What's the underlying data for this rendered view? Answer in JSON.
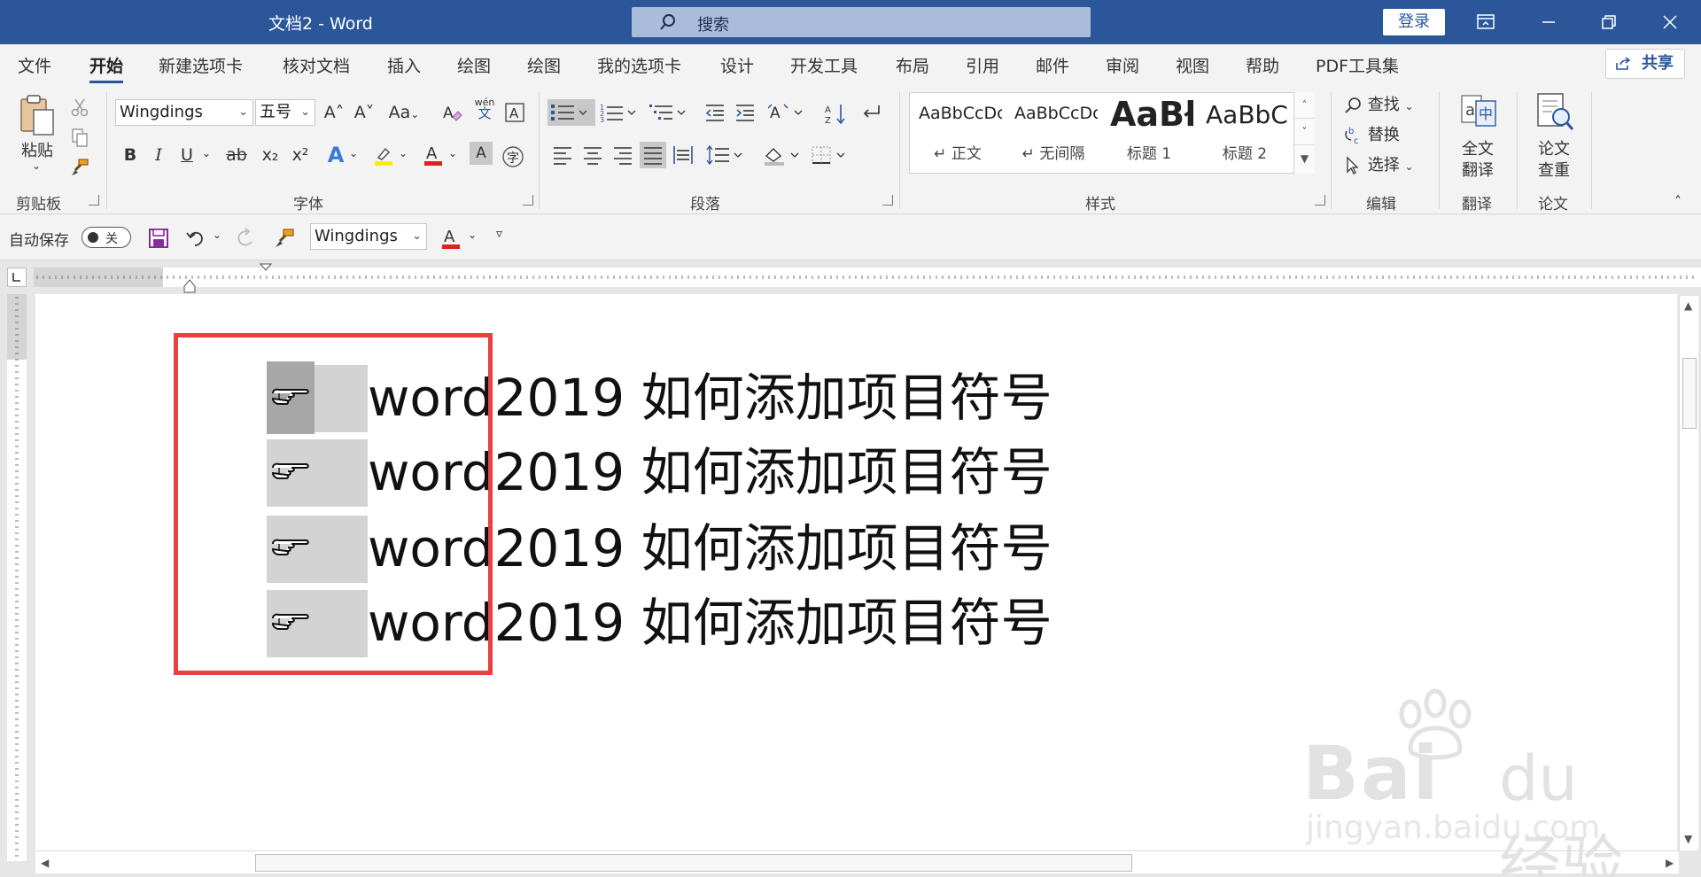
{
  "window": {
    "title": "文档2  -  Word",
    "search_label": "搜索",
    "login_label": "登录",
    "share_label": "共享"
  },
  "menu_tabs": [
    "文件",
    "开始",
    "新建选项卡",
    "核对文档",
    "插入",
    "绘图",
    "绘图",
    "我的选项卡",
    "设计",
    "开发工具",
    "布局",
    "引用",
    "邮件",
    "审阅",
    "视图",
    "帮助",
    "PDF工具集"
  ],
  "active_tab": "开始",
  "ribbon": {
    "clipboard": {
      "paste_label": "粘贴",
      "group_label": "剪贴板"
    },
    "font": {
      "font_name": "Wingdings",
      "font_size": "五号",
      "group_label": "字体",
      "grow": "A˄",
      "shrink": "A˅",
      "case": "Aa",
      "phonetic": "wén",
      "phonetic_char": "文",
      "bold": "B",
      "italic": "I",
      "underline": "U",
      "strike": "ab",
      "subscript": "x₂",
      "superscript": "x²",
      "color_a": "A",
      "enclose": "字"
    },
    "paragraph": {
      "group_label": "段落"
    },
    "styles": {
      "group_label": "样式",
      "items": [
        {
          "sample": "AaBbCcDc",
          "name": "↵ 正文"
        },
        {
          "sample": "AaBbCcDc",
          "name": "↵ 无间隔"
        },
        {
          "sample": "AaBł",
          "name": "标题 1"
        },
        {
          "sample": "AaBbC",
          "name": "标题 2"
        }
      ]
    },
    "editing": {
      "find": "查找",
      "replace": "替换",
      "select": "选择",
      "group_label": "编辑"
    },
    "translate": {
      "label_line1": "全文",
      "label_line2": "翻译",
      "group_label": "翻译"
    },
    "paper": {
      "label_line1": "论文",
      "label_line2": "查重",
      "group_label": "论文"
    }
  },
  "quick_access": {
    "autosave_label": "自动保存",
    "autosave_state": "关",
    "font_name": "Wingdings"
  },
  "document": {
    "lines": [
      "word2019 如何添加项目符号",
      "word2019 如何添加项目符号",
      "word2019 如何添加项目符号",
      "word2019 如何添加项目符号"
    ]
  },
  "watermark": {
    "brand": "Bai",
    "brand_suffix": "du经验",
    "url": "jingyan.baidu.com"
  },
  "colors": {
    "title_bar": "#2b579a",
    "highlight_box": "#e94040",
    "font_color_bar": "#e02020",
    "highlight_yellow": "#ffee00"
  }
}
